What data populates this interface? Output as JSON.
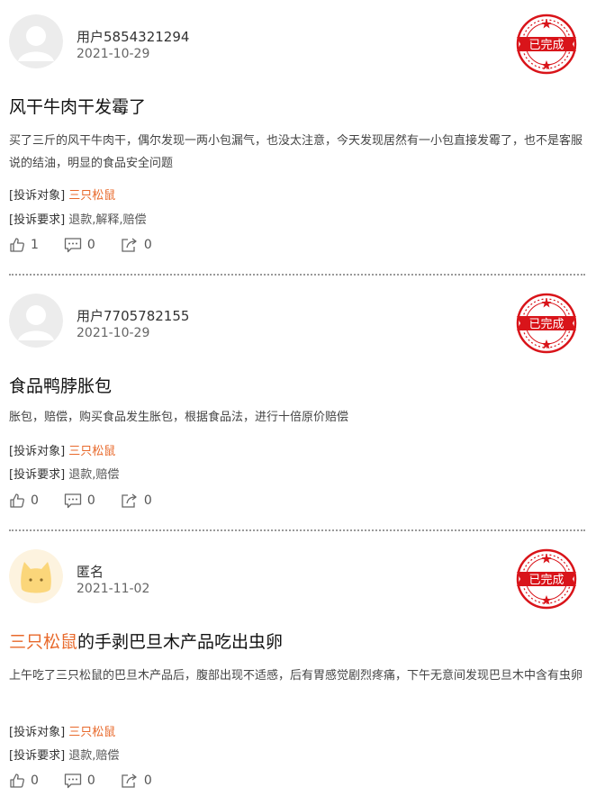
{
  "complaints": [
    {
      "user": "用户5854321294",
      "date": "2021-10-29",
      "status": "已完成",
      "title_pre": "",
      "title_brand": "",
      "title_post": "风干牛肉干发霉了",
      "body": "买了三斤的风干牛肉干，偶尔发现一两小包漏气，也没太注意，今天发现居然有一小包直接发霉了，也不是客服说的结油，明显的食品安全问题",
      "target_label": "[投诉对象]",
      "target": "三只松鼠",
      "demand_label": "[投诉要求]",
      "demand": "退款,解释,赔偿",
      "likes": "1",
      "comments": "0",
      "shares": "0"
    },
    {
      "user": "用户7705782155",
      "date": "2021-10-29",
      "status": "已完成",
      "title_pre": "",
      "title_brand": "",
      "title_post": "食品鸭脖胀包",
      "body": "胀包，赔偿，购买食品发生胀包，根据食品法，进行十倍原价赔偿",
      "target_label": "[投诉对象]",
      "target": "三只松鼠",
      "demand_label": "[投诉要求]",
      "demand": "退款,赔偿",
      "likes": "0",
      "comments": "0",
      "shares": "0"
    },
    {
      "user": "匿名",
      "date": "2021-11-02",
      "status": "已完成",
      "title_pre": "",
      "title_brand": "三只松鼠",
      "title_post": "的手剥巴旦木产品吃出虫卵",
      "body": "上午吃了三只松鼠的巴旦木产品后，腹部出现不适感，后有胃感觉剧烈疼痛，下午无意间发现巴旦木中含有虫卵",
      "target_label": "[投诉对象]",
      "target": "三只松鼠",
      "demand_label": "[投诉要求]",
      "demand": "退款,赔偿",
      "likes": "0",
      "comments": "0",
      "shares": "0"
    }
  ],
  "colors": {
    "accent": "#e8692b",
    "stamp_red": "#d9141a",
    "separator": "#9a9a9a"
  },
  "icons": {
    "like": "thumbs-up-icon",
    "comment": "comment-icon",
    "share": "share-icon",
    "status": "completed-stamp-icon"
  }
}
